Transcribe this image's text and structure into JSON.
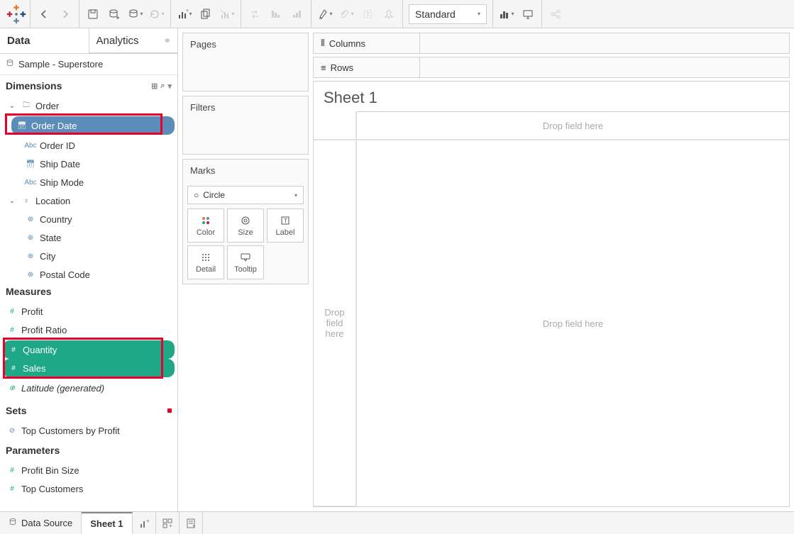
{
  "tabs": {
    "data": "Data",
    "analytics": "Analytics"
  },
  "datasource": "Sample - Superstore",
  "sections": {
    "dimensions": "Dimensions",
    "measures": "Measures",
    "sets": "Sets",
    "parameters": "Parameters"
  },
  "dims": {
    "order_folder": "Order",
    "order_date": "Order Date",
    "order_id": "Order ID",
    "ship_date": "Ship Date",
    "ship_mode": "Ship Mode",
    "location_folder": "Location",
    "country": "Country",
    "state": "State",
    "city": "City",
    "postal_code": "Postal Code"
  },
  "meas": {
    "profit": "Profit",
    "profit_ratio": "Profit Ratio",
    "quantity": "Quantity",
    "sales": "Sales",
    "latitude": "Latitude (generated)"
  },
  "sets": {
    "top_customers": "Top Customers by Profit"
  },
  "params": {
    "profit_bin": "Profit Bin Size",
    "top_customers": "Top Customers"
  },
  "shelves": {
    "pages": "Pages",
    "filters": "Filters",
    "marks": "Marks",
    "columns": "Columns",
    "rows": "Rows"
  },
  "marks": {
    "type": "Circle",
    "cells": {
      "color": "Color",
      "size": "Size",
      "label": "Label",
      "detail": "Detail",
      "tooltip": "Tooltip"
    }
  },
  "sheet": {
    "title": "Sheet 1",
    "drop_col": "Drop field here",
    "drop_row": "Drop field here",
    "drop_body": "Drop field here"
  },
  "toolbar": {
    "fit": "Standard"
  },
  "bottom": {
    "datasource": "Data Source",
    "sheet1": "Sheet 1"
  }
}
